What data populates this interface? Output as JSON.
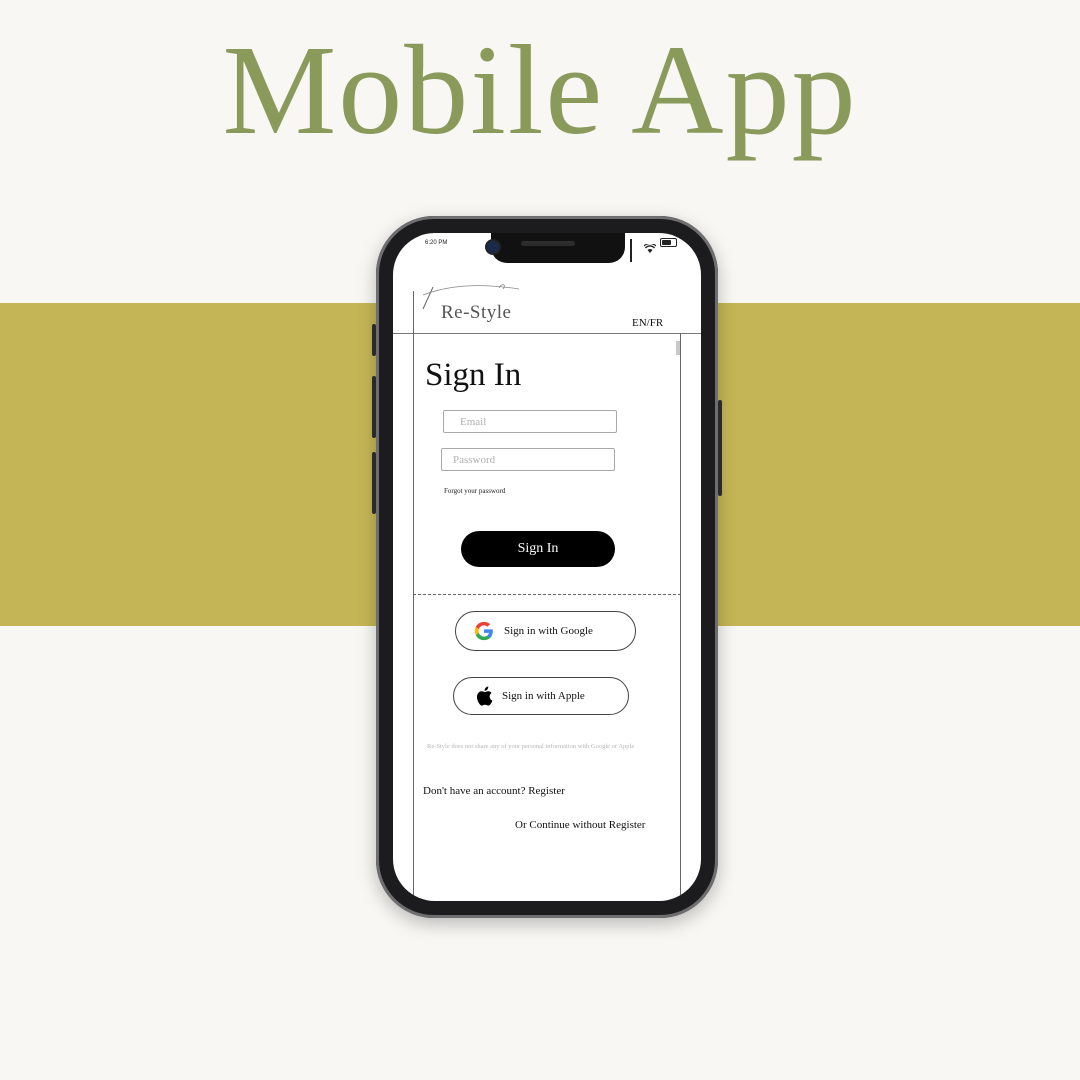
{
  "page": {
    "title": "Mobile App"
  },
  "colors": {
    "title": "#8a9a5b",
    "band": "#c4b656",
    "background": "#f8f7f3"
  },
  "status_bar": {
    "time": "6:20 PM"
  },
  "app": {
    "logo_text": "Re-Style",
    "language_toggle": "EN/FR"
  },
  "signin": {
    "title": "Sign In",
    "email_placeholder": "Email",
    "password_placeholder": "Password",
    "forgot_label": "Forgot your password",
    "button_label": "Sign In",
    "google_label": "Sign in with Google",
    "apple_label": "Sign in with Apple",
    "disclaimer": "Re-Style does not share any of your personal information with Google or Apple",
    "register_label": "Don't have an account? Register",
    "continue_label": "Or Continue without Register"
  },
  "icons": [
    "google-icon",
    "apple-icon",
    "signal-icon",
    "wifi-icon",
    "battery-icon"
  ]
}
